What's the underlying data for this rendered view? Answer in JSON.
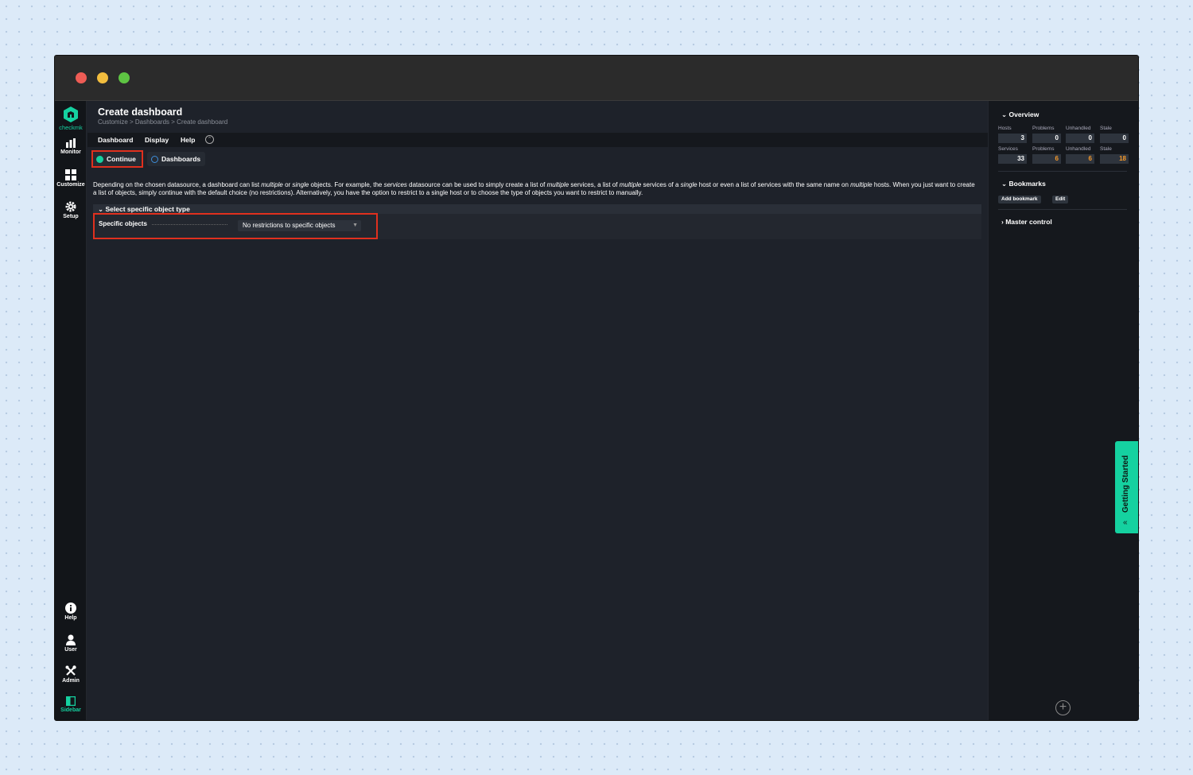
{
  "app": {
    "logo_text": "checkmk"
  },
  "leftnav": {
    "monitor": "Monitor",
    "customize": "Customize",
    "setup": "Setup",
    "help": "Help",
    "user": "User",
    "admin": "Admin",
    "sidebar": "Sidebar"
  },
  "header": {
    "title": "Create dashboard",
    "breadcrumb": "Customize > Dashboards > Create dashboard"
  },
  "menu": {
    "dashboard": "Dashboard",
    "display": "Display",
    "help": "Help"
  },
  "toolbar": {
    "continue": "Continue",
    "dashboards": "Dashboards"
  },
  "intro": {
    "p1": "Depending on the chosen datasource, a dashboard can list ",
    "multiple1": "multiple",
    "p2": " or ",
    "single1": "single",
    "p3": " objects. For example, the ",
    "services": "services",
    "p4": " datasource can be used to simply create a list of ",
    "multiple2": "multiple",
    "p5": " services, a list of ",
    "multiple3": "multiple",
    "p6": " services of a ",
    "single2": "single",
    "p7": " host or even a list of services with the same name on ",
    "multiple4": "multiple",
    "p8": " hosts. When you just want to create a list of objects, simply continue with the default choice (no restrictions). Alternatively, you have the option to restrict to a single host or to choose the type of objects you want to restrict to manually."
  },
  "section": {
    "title": "Select specific object type",
    "field_label": "Specific objects",
    "select_value": "No restrictions to specific objects"
  },
  "rightbar": {
    "overview": {
      "title": "Overview",
      "host_labels": [
        "Hosts",
        "Problems",
        "Unhandled",
        "Stale"
      ],
      "host_values": [
        "3",
        "0",
        "0",
        "0"
      ],
      "service_labels": [
        "Services",
        "Problems",
        "Unhandled",
        "Stale"
      ],
      "service_values": [
        "33",
        "6",
        "6",
        "18"
      ]
    },
    "bookmarks": {
      "title": "Bookmarks",
      "add": "Add bookmark",
      "edit": "Edit"
    },
    "master_control": {
      "title": "Master control"
    },
    "getting_started": "Getting Started"
  },
  "colors": {
    "accent": "#15d1a0",
    "highlight": "#e0301e",
    "warn": "#f79a2b"
  }
}
